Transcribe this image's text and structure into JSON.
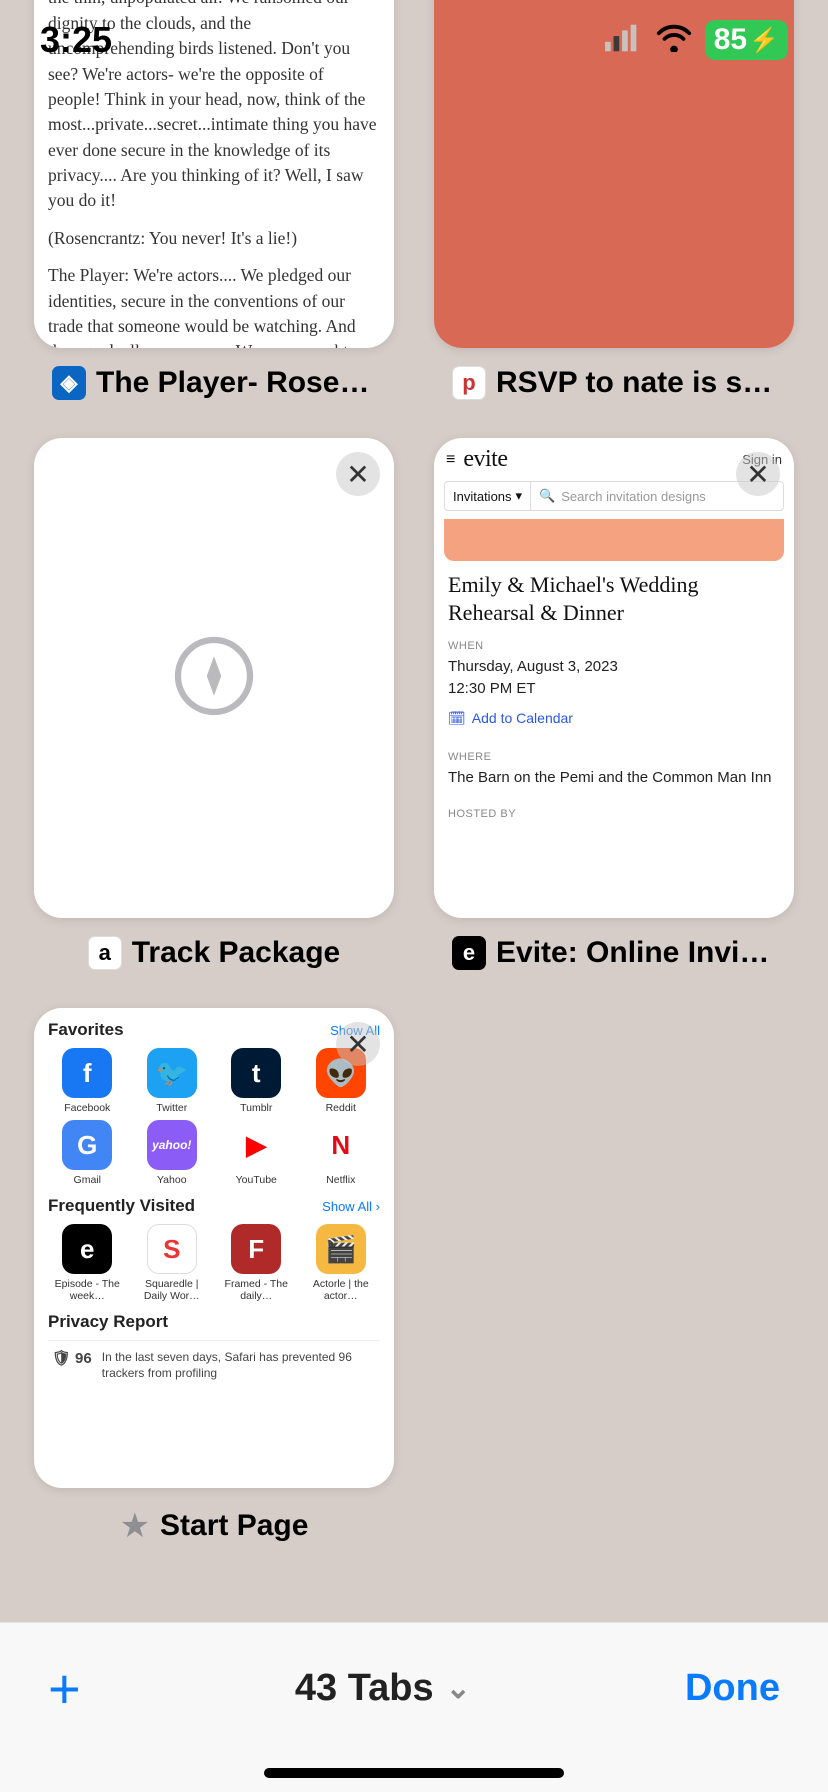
{
  "status": {
    "time": "3:25",
    "battery": "85"
  },
  "tabs": [
    {
      "title": "The Player- Rosencran…",
      "article": {
        "p1": "and every gesture, every pose, vanishing into the thin, unpopulated air. We ransomed our dignity to the clouds, and the uncomprehending birds listened. Don't you see? We're actors- we're the opposite of people! Think in your head, now, think of the most...private...secret...intimate thing you have ever done secure in the knowledge of its privacy.... Are you thinking of it? Well, I saw you do it!",
        "p2": "(Rosencrantz: You never! It's a lie!)",
        "p3": "The Player: We're actors.... We pledged our identities, secure in the conventions of our trade that someone would be watching. And then  gradually  no one was  We were caught"
      }
    },
    {
      "title": "RSVP to nate is still aliv…"
    },
    {
      "title": "Track Package"
    },
    {
      "title": "Evite: Online Invitation…",
      "evite": {
        "logo": "evite",
        "signin": "Sign in",
        "dropdown": "Invitations",
        "placeholder": "Search invitation designs",
        "event_title": "Emily & Michael's Wedding Rehearsal & Dinner",
        "when_lbl": "WHEN",
        "when_date": "Thursday, August 3, 2023",
        "when_time": "12:30 PM ET",
        "add_cal": "Add to Calendar",
        "where_lbl": "WHERE",
        "where_val": "The Barn on the Pemi and the Common Man Inn",
        "hosted_lbl": "HOSTED BY"
      }
    },
    {
      "title": "Start Page",
      "startpage": {
        "fav_lbl": "Favorites",
        "show_all": "Show All",
        "freq_lbl": "Frequently Visited",
        "priv_lbl": "Privacy Report",
        "priv_count": "96",
        "priv_text": "In the last seven days, Safari has prevented 96 trackers from profiling",
        "favorites": [
          {
            "name": "Facebook",
            "letter": "f",
            "bg": "#1877f2"
          },
          {
            "name": "Twitter",
            "letter": "",
            "bg": "#1da1f2"
          },
          {
            "name": "Tumblr",
            "letter": "t",
            "bg": "#001935"
          },
          {
            "name": "Reddit",
            "letter": "",
            "bg": "#ff4500"
          },
          {
            "name": "Gmail",
            "letter": "G",
            "bg": "#4285f4"
          },
          {
            "name": "Yahoo",
            "letter": "yahoo!",
            "bg": "#8b5cf6"
          },
          {
            "name": "YouTube",
            "letter": "▶",
            "bg": "#ffffff"
          },
          {
            "name": "Netflix",
            "letter": "N",
            "bg": "#ffffff"
          }
        ],
        "frequent": [
          {
            "name": "Episode - The week…",
            "letter": "e",
            "bg": "#000"
          },
          {
            "name": "Squaredle | Daily Wor…",
            "letter": "S",
            "bg": "#fff"
          },
          {
            "name": "Framed - The daily…",
            "letter": "F",
            "bg": "#b02a2a"
          },
          {
            "name": "Actorle | the actor…",
            "letter": "",
            "bg": "#f5b942"
          }
        ]
      }
    }
  ],
  "toolbar": {
    "tabs_count": "43 Tabs",
    "done": "Done"
  }
}
